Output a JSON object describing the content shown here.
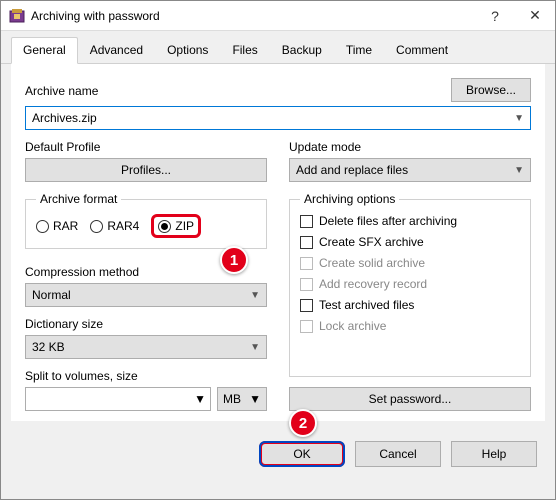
{
  "window": {
    "title": "Archiving with password",
    "help_glyph": "?",
    "close_glyph": "✕"
  },
  "tabs": [
    "General",
    "Advanced",
    "Options",
    "Files",
    "Backup",
    "Time",
    "Comment"
  ],
  "browse_label": "Browse...",
  "archive_name_label": "Archive name",
  "archive_name_value": "Archives.zip",
  "default_profile_label": "Default Profile",
  "profiles_btn": "Profiles...",
  "update_mode_label": "Update mode",
  "update_mode_value": "Add and replace files",
  "archive_format_label": "Archive format",
  "formats": {
    "rar": "RAR",
    "rar4": "RAR4",
    "zip": "ZIP"
  },
  "compression_label": "Compression method",
  "compression_value": "Normal",
  "dict_label": "Dictionary size",
  "dict_value": "32 KB",
  "split_label": "Split to volumes, size",
  "split_unit": "MB",
  "archiving_options_label": "Archiving options",
  "opts": {
    "delete": "Delete files after archiving",
    "sfx": "Create SFX archive",
    "solid": "Create solid archive",
    "recovery": "Add recovery record",
    "test": "Test archived files",
    "lock": "Lock archive"
  },
  "set_password_btn": "Set password...",
  "footer": {
    "ok": "OK",
    "cancel": "Cancel",
    "help": "Help"
  },
  "badges": {
    "one": "1",
    "two": "2"
  }
}
